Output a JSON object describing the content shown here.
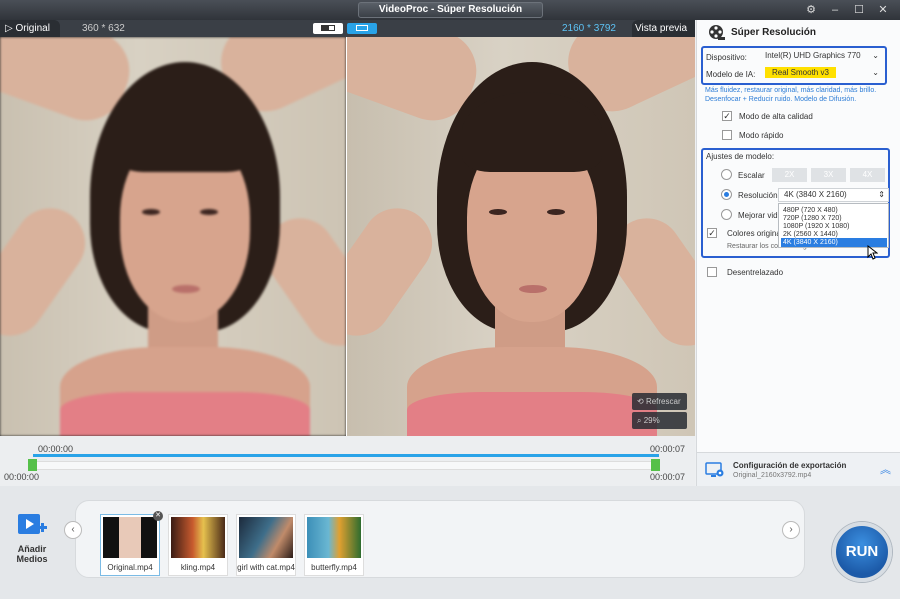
{
  "window": {
    "title": "VideoProc - Súper Resolución",
    "controls": [
      "⚙",
      "–",
      "☐",
      "✕"
    ]
  },
  "preview": {
    "original_label": "Original",
    "original_res": "360 * 632",
    "output_res": "2160 * 3792",
    "preview_label": "Vista previa",
    "refresh_label": "Refrescar",
    "zoom_label": "29%"
  },
  "timeline": {
    "start_top": "00:00:00",
    "end_top": "00:00:07",
    "start_bottom": "00:00:00",
    "end_bottom": "00:00:07"
  },
  "panel": {
    "title": "Súper Resolución",
    "device_label": "Dispositivo:",
    "device_value": "Intel(R) UHD Graphics 770",
    "model_label": "Modelo de IA:",
    "model_value": "Real Smooth v3",
    "hint_lines": [
      "Más fluidez, restaurar original, más claridad, más brillo.",
      "Desenfocar + Reducir ruido. Modelo de Difusión."
    ],
    "hq_label": "Modo de alta calidad",
    "fast_label": "Modo rápido",
    "settings_title": "Ajustes de modelo:",
    "scale_label": "Escalar",
    "scale_options": [
      "2X",
      "3X",
      "4X"
    ],
    "resolution_label": "Resolución",
    "resolution_value": "4K (3840 X 2160)",
    "improve_label": "Mejorar vid",
    "colors_label": "Colores original",
    "colors_hint": "Restaurar los colores originales del vídeo.",
    "resolution_options": [
      "480P (720 X 480)",
      "720P (1280 X 720)",
      "1080P (1920 X 1080)",
      "2K (2560 X 1440)",
      "4K (3840 X 2160)"
    ],
    "deinterlace_label": "Desentrelazado",
    "export_title": "Configuración de exportación",
    "export_sub": "Original_2160x3792.mp4"
  },
  "media": {
    "add_label": "Añadir Medios",
    "files": [
      {
        "name": "Original.mp4"
      },
      {
        "name": "kling.mp4"
      },
      {
        "name": "girl with cat.mp4"
      },
      {
        "name": "butterfly.mp4"
      }
    ],
    "run_label": "RUN"
  },
  "colors": {
    "accent": "#29a3e8",
    "highlight_box": "#2a5fd0",
    "model_highlight": "#ffe000",
    "handle_green": "#55c049"
  }
}
